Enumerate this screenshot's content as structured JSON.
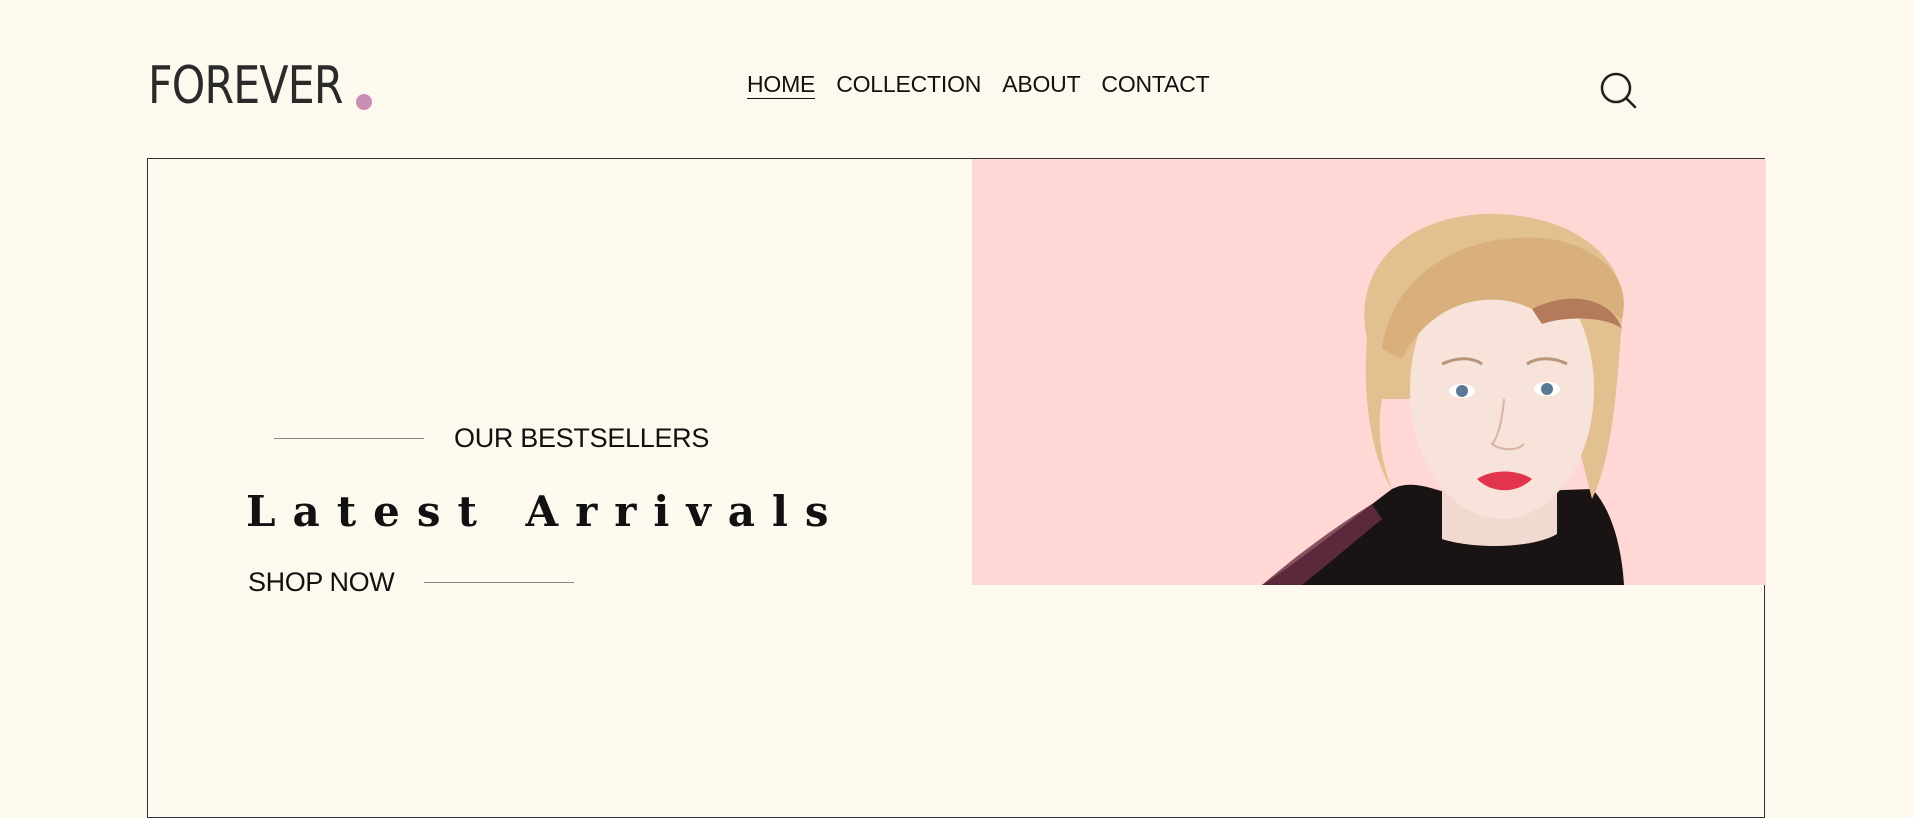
{
  "brand": {
    "name": "FOREVER",
    "dot_color": "#c98fb3"
  },
  "nav": {
    "items": [
      {
        "label": "HOME",
        "active": true
      },
      {
        "label": "COLLECTION",
        "active": false
      },
      {
        "label": "ABOUT",
        "active": false
      },
      {
        "label": "CONTACT",
        "active": false
      }
    ]
  },
  "search": {
    "icon": "search-icon"
  },
  "hero": {
    "eyebrow": "OUR BESTSELLERS",
    "title": "Latest Arrivals",
    "cta": "SHOP NOW",
    "image_bg": "#ffd8d6"
  }
}
